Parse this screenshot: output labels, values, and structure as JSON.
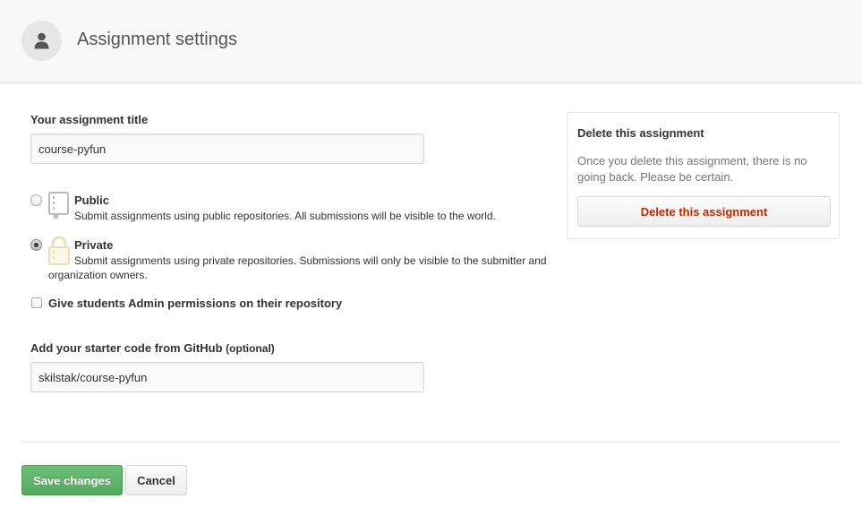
{
  "header": {
    "title": "Assignment settings",
    "avatar_icon": "person-icon"
  },
  "form": {
    "title_label": "Your assignment title",
    "title_value": "course-pyfun",
    "visibility": {
      "selected": "private",
      "public": {
        "label": "Public",
        "description": "Submit assignments using public repositories. All submissions will be visible to the world.",
        "icon": "repo-book-icon",
        "checked": false
      },
      "private": {
        "label": "Private",
        "description_line1": "Submit assignments using private repositories. Submissions will only be visible to the submitter and",
        "description_line2": "organization owners.",
        "icon": "lock-icon",
        "checked": true
      }
    },
    "admin_permissions": {
      "label": "Give students Admin permissions on their repository",
      "checked": false
    },
    "starter_code_label": "Add your starter code from GitHub",
    "starter_code_optional": "(optional)",
    "starter_code_value": "skilstak/course-pyfun"
  },
  "danger": {
    "title": "Delete this assignment",
    "description": "Once you delete this assignment, there is no going back. Please be certain.",
    "button_label": "Delete this assignment",
    "button_color": "#bd2c00"
  },
  "actions": {
    "save_label": "Save changes",
    "cancel_label": "Cancel",
    "save_color": "#5cb468"
  }
}
